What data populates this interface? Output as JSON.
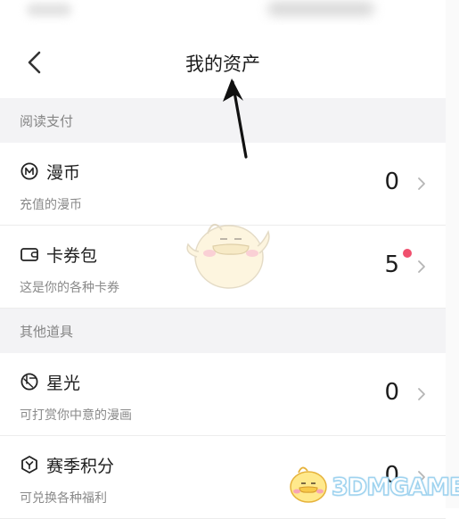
{
  "header": {
    "title": "我的资产"
  },
  "sections": [
    {
      "label": "阅读支付",
      "items": [
        {
          "icon": "m-coin-icon",
          "title": "漫币",
          "subtitle": "充值的漫币",
          "value": "0"
        },
        {
          "icon": "card-wallet-icon",
          "title": "卡券包",
          "subtitle": "这是你的各种卡券",
          "value": "5",
          "badge": true
        }
      ]
    },
    {
      "label": "其他道具",
      "items": [
        {
          "icon": "starlight-icon",
          "title": "星光",
          "subtitle": "可打赏你中意的漫画",
          "value": "0"
        },
        {
          "icon": "season-points-icon",
          "title": "赛季积分",
          "subtitle": "可兑换各种福利",
          "value": "0"
        }
      ]
    }
  ],
  "colors": {
    "badge": "#f0506e",
    "section_bg": "#f3f3f5",
    "annotation_arrow": "#111111",
    "watermark": "#9fd3ef"
  },
  "watermark": {
    "text": "3DMGAME"
  }
}
